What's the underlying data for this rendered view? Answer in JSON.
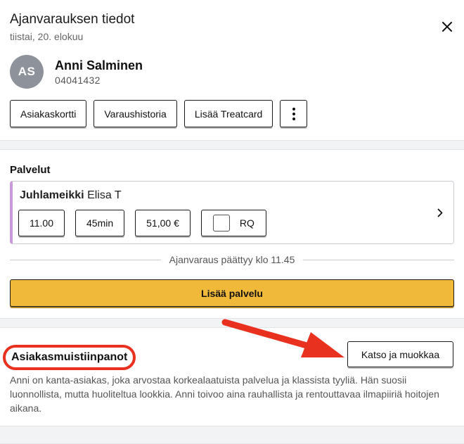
{
  "header": {
    "title": "Ajanvarauksen tiedot",
    "date": "tiistai, 20. elokuu"
  },
  "customer": {
    "initials": "AS",
    "name": "Anni Salminen",
    "phone": "04041432"
  },
  "actions": {
    "card": "Asiakaskortti",
    "history": "Varaushistoria",
    "treatcard": "Lisää Treatcard",
    "more_icon": "kebab-vertical-icon"
  },
  "services": {
    "title": "Palvelut",
    "item": {
      "name": "Juhlameikki",
      "staff": "Elisa T",
      "time": "11.00",
      "duration": "45min",
      "price": "51,00 €",
      "rq": "RQ",
      "accent_color": "#c79ad8"
    },
    "end_note": "Ajanvaraus päättyy klo 11.45",
    "add_label": "Lisää palvelu"
  },
  "notes": {
    "title": "Asiakasmuistiinpanot",
    "view_edit": "Katso ja muokkaa",
    "text": "Anni on kanta-asiakas, joka arvostaa korkealaatuista palvelua ja klassista tyyliä. Hän suosii luonnollista, mutta huoliteltua lookkia. Anni toivoo aina rauhallista ja rentouttavaa ilmapiiriä hoitojen aikana."
  },
  "colors": {
    "primary_button": "#f0b93a",
    "annotation_red": "#e8321f"
  }
}
